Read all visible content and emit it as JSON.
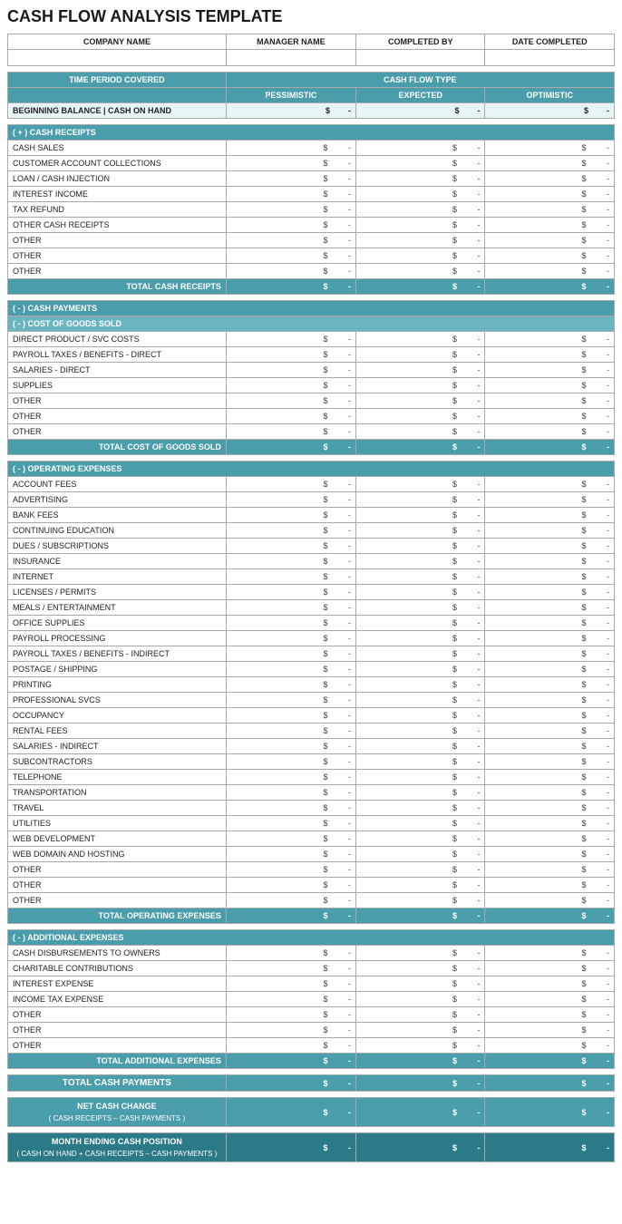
{
  "title": "CASH FLOW ANALYSIS TEMPLATE",
  "header": {
    "company_name": "COMPANY NAME",
    "manager_name": "MANAGER NAME",
    "completed_by": "COMPLETED BY",
    "date_completed": "DATE COMPLETED",
    "time_period": "TIME PERIOD COVERED",
    "cash_flow_type": "CASH FLOW TYPE",
    "pessimistic": "PESSIMISTIC",
    "expected": "EXPECTED",
    "optimistic": "OPTIMISTIC"
  },
  "beginning_balance": "BEGINNING BALANCE | CASH ON HAND",
  "sections": {
    "cash_receipts_header": "( + )  CASH RECEIPTS",
    "cash_receipts_items": [
      "CASH SALES",
      "CUSTOMER ACCOUNT COLLECTIONS",
      "LOAN / CASH INJECTION",
      "INTEREST INCOME",
      "TAX REFUND",
      "OTHER CASH RECEIPTS",
      "OTHER",
      "OTHER",
      "OTHER"
    ],
    "total_cash_receipts": "TOTAL CASH RECEIPTS",
    "cash_payments_header": "( - )  CASH PAYMENTS",
    "cost_of_goods_header": "( - )  COST OF GOODS SOLD",
    "cost_items": [
      "DIRECT PRODUCT / SVC COSTS",
      "PAYROLL TAXES / BENEFITS - DIRECT",
      "SALARIES - DIRECT",
      "SUPPLIES",
      "OTHER",
      "OTHER",
      "OTHER"
    ],
    "total_cogs": "TOTAL COST OF GOODS SOLD",
    "operating_expenses_header": "( - )  OPERATING EXPENSES",
    "operating_items": [
      "ACCOUNT FEES",
      "ADVERTISING",
      "BANK FEES",
      "CONTINUING EDUCATION",
      "DUES / SUBSCRIPTIONS",
      "INSURANCE",
      "INTERNET",
      "LICENSES / PERMITS",
      "MEALS / ENTERTAINMENT",
      "OFFICE SUPPLIES",
      "PAYROLL PROCESSING",
      "PAYROLL TAXES / BENEFITS - INDIRECT",
      "POSTAGE / SHIPPING",
      "PRINTING",
      "PROFESSIONAL SVCS",
      "OCCUPANCY",
      "RENTAL FEES",
      "SALARIES - INDIRECT",
      "SUBCONTRACTORS",
      "TELEPHONE",
      "TRANSPORTATION",
      "TRAVEL",
      "UTILITIES",
      "WEB DEVELOPMENT",
      "WEB DOMAIN AND HOSTING",
      "OTHER",
      "OTHER",
      "OTHER"
    ],
    "total_operating": "TOTAL OPERATING EXPENSES",
    "additional_header": "( - )  ADDITIONAL EXPENSES",
    "additional_items": [
      "CASH DISBURSEMENTS TO OWNERS",
      "CHARITABLE CONTRIBUTIONS",
      "INTEREST EXPENSE",
      "INCOME TAX EXPENSE",
      "OTHER",
      "OTHER",
      "OTHER"
    ],
    "total_additional": "TOTAL ADDITIONAL EXPENSES",
    "total_cash_payments": "TOTAL CASH PAYMENTS",
    "net_cash_change": "NET CASH CHANGE",
    "net_cash_sub": "( CASH RECEIPTS – CASH PAYMENTS )",
    "month_ending": "MONTH ENDING CASH POSITION",
    "month_ending_sub": "( CASH ON HAND + CASH RECEIPTS – CASH PAYMENTS )"
  },
  "currency_symbol": "$",
  "dash": "-"
}
